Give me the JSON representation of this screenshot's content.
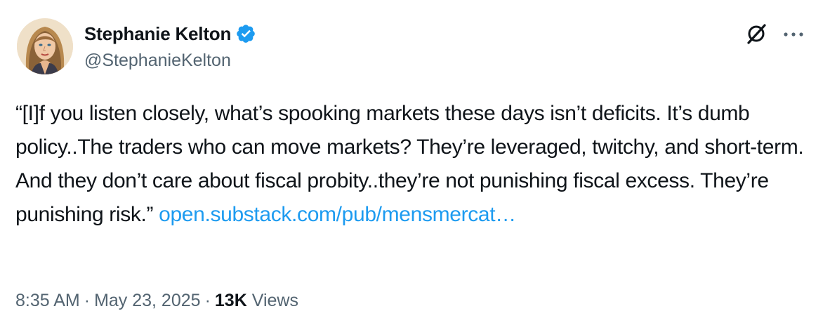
{
  "author": {
    "display_name": "Stephanie Kelton",
    "handle": "@StephanieKelton",
    "verified": true
  },
  "tweet": {
    "text": "“[I]f you listen closely, what’s spooking markets these days isn’t deficits. It’s dumb policy..The traders who can move markets? They’re leveraged, twitchy, and short-term. And they don’t care about fiscal probity..they’re not punishing fiscal excess. They’re punishing risk.” ",
    "link_text": "open.substack.com/pub/mensmercat…"
  },
  "meta": {
    "time": "8:35 AM",
    "separator": "·",
    "date": "May 23, 2025",
    "views_count": "13K",
    "views_label": "Views"
  },
  "icons": {
    "verified": "verified-badge-icon",
    "grok": "grok-icon",
    "more": "more-options-icon"
  },
  "colors": {
    "link": "#1d9bf0",
    "verified": "#1d9bf0",
    "secondary_text": "#536471",
    "primary_text": "#0f1419"
  }
}
